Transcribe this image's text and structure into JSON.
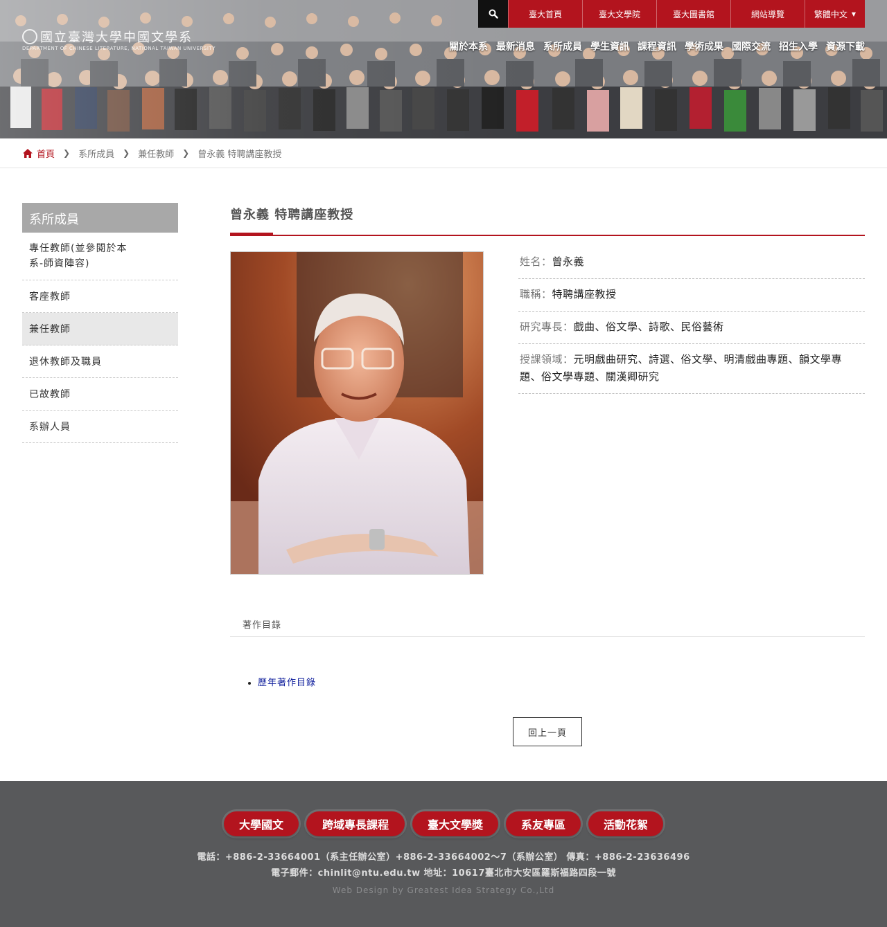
{
  "header": {
    "logo_text": "國立臺灣大學中國文學系",
    "logo_sub": "DEPARTMENT OF CHINESE LITERATURE, NATIONAL TAIWAN UNIVERSITY",
    "top_links": [
      "臺大首頁",
      "臺大文學院",
      "臺大圖書館",
      "網站導覽"
    ],
    "language": "繁體中文",
    "nav": [
      "關於本系",
      "最新消息",
      "系所成員",
      "學生資訊",
      "課程資訊",
      "學術成果",
      "國際交流",
      "招生入學",
      "資源下載"
    ],
    "accent_color": "#b3141e"
  },
  "breadcrumb": {
    "home": "首頁",
    "items": [
      "系所成員",
      "兼任教師",
      "曾永義 特聘講座教授"
    ]
  },
  "sidebar": {
    "title": "系所成員",
    "items": [
      {
        "label": "專任教師(並參閱於本系-師資陣容)"
      },
      {
        "label": "客座教師"
      },
      {
        "label": "兼任教師"
      },
      {
        "label": "退休教師及職員"
      },
      {
        "label": "已故教師"
      },
      {
        "label": "系辦人員"
      }
    ],
    "active_index": 2
  },
  "profile": {
    "page_title": "曾永義 特聘講座教授",
    "fields": [
      {
        "key": "姓名：",
        "value": "曾永義"
      },
      {
        "key": "職稱：",
        "value": "特聘講座教授"
      },
      {
        "key": "研究專長：",
        "value": "戲曲、俗文學、詩歌、民俗藝術"
      },
      {
        "key": "授課領域：",
        "value": "元明戲曲研究、詩選、俗文學、明清戲曲專題、韻文學專題、俗文學專題、關漢卿研究"
      }
    ],
    "tab_label": "著作目錄",
    "publications": [
      "歷年著作目錄"
    ],
    "back_label": "回上一頁"
  },
  "footer": {
    "buttons": [
      "大學國文",
      "跨域專長課程",
      "臺大文學獎",
      "系友專區",
      "活動花絮"
    ],
    "contact_line1": "電話：+886-2-33664001（系主任辦公室）+886-2-33664002～7（系辦公室） 傳真：+886-2-23636496",
    "contact_line2": "電子郵件：chinlit@ntu.edu.tw 地址：10617臺北市大安區羅斯福路四段一號",
    "credit": "Web Design by Greatest Idea Strategy Co.,Ltd"
  }
}
